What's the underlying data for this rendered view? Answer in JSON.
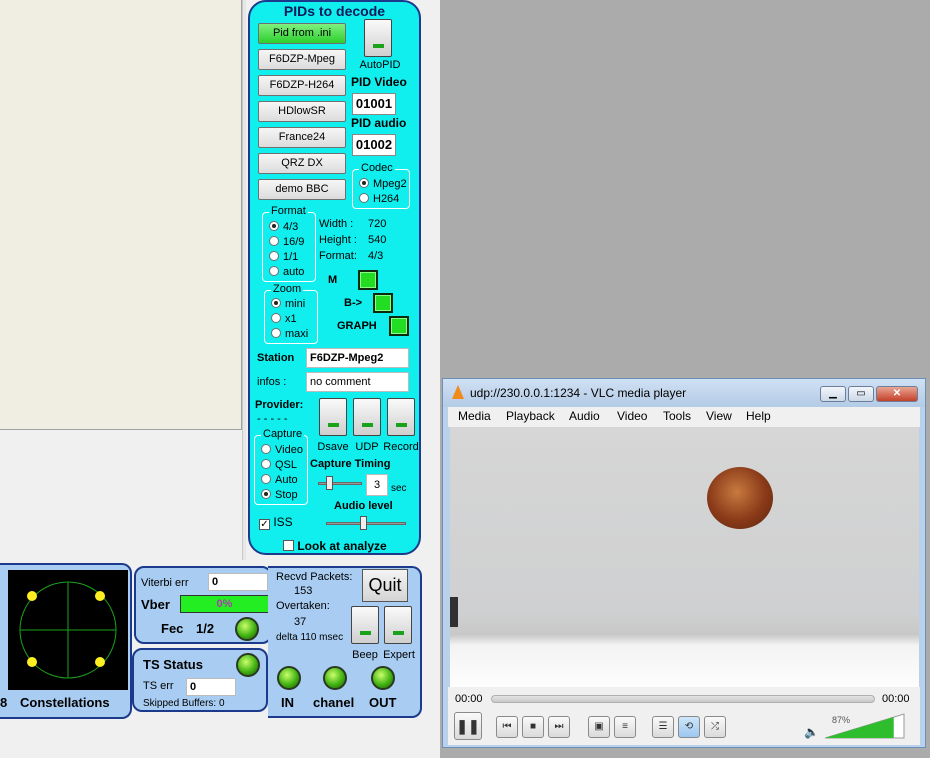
{
  "pid_panel": {
    "title": "PIDs to decode",
    "buttons": [
      "Pid from .ini",
      "F6DZP-Mpeg",
      "F6DZP-H264",
      "HDlowSR",
      "France24",
      "QRZ DX",
      "demo BBC"
    ],
    "autopid_label": "AutoPID",
    "pid_video_label": "PID Video",
    "pid_video_value": "01001",
    "pid_audio_label": "PID audio",
    "pid_audio_value": "01002",
    "codec": {
      "title": "Codec",
      "options": [
        "Mpeg2",
        "H264"
      ],
      "selected": "Mpeg2"
    },
    "format": {
      "title": "Format",
      "options": [
        "4/3",
        "16/9",
        "1/1",
        "auto"
      ],
      "selected": "4/3"
    },
    "video_info": {
      "width_label": "Width :",
      "width_value": "720",
      "height_label": "Height :",
      "height_value": "540",
      "format_label": "Format:",
      "format_value": "4/3"
    },
    "zoom": {
      "title": "Zoom",
      "options": [
        "mini",
        "x1",
        "maxi"
      ],
      "selected": "mini"
    },
    "m_label": "M",
    "b_label": "B->",
    "graph_label": "GRAPH",
    "station_label": "Station",
    "station_value": "F6DZP-Mpeg2",
    "infos_label": "infos :",
    "infos_value": "no comment",
    "provider_label": "Provider:",
    "provider_value": "- - - - -",
    "switch_labels": [
      "Dsave",
      "UDP",
      "Record"
    ],
    "capture": {
      "title": "Capture",
      "options": [
        "Video",
        "QSL",
        "Auto",
        "Stop"
      ],
      "selected": "Stop"
    },
    "capture_timing_label": "Capture Timing",
    "capture_timing_value": "3",
    "capture_timing_unit": "sec",
    "audio_level_label": "Audio level",
    "iss_label": "ISS",
    "look_label": "Look at analyze"
  },
  "status": {
    "constellation_label": "Constellations",
    "constellation_prefix": "8",
    "viterbi_label": "Viterbi err",
    "viterbi_value": "0",
    "vber_label": "Vber",
    "vber_value": "0%",
    "fec_label": "Fec",
    "fec_value": "1/2",
    "recvd_label": "Recvd Packets:",
    "recvd_value": "153",
    "overtaken_label": "Overtaken:",
    "overtaken_value": "37",
    "delta_label": "delta 110 msec",
    "quit_label": "Quit",
    "beep_label": "Beep",
    "expert_label": "Expert",
    "ts_status_label": "TS Status",
    "ts_err_label": "TS err",
    "ts_err_value": "0",
    "skipped_label": "Skipped Buffers: 0",
    "in_label": "IN",
    "chanel_label": "chanel",
    "out_label": "OUT"
  },
  "vlc": {
    "title": "udp://230.0.0.1:1234 - VLC media player",
    "menu": [
      "Media",
      "Playback",
      "Audio",
      "Video",
      "Tools",
      "View",
      "Help"
    ],
    "time_elapsed": "00:00",
    "time_total": "00:00",
    "volume_label": "87%",
    "volume": 0.87,
    "colors": {
      "accent": "#11eeee",
      "frame": "#1b3a8c",
      "led": "#42b313"
    }
  }
}
